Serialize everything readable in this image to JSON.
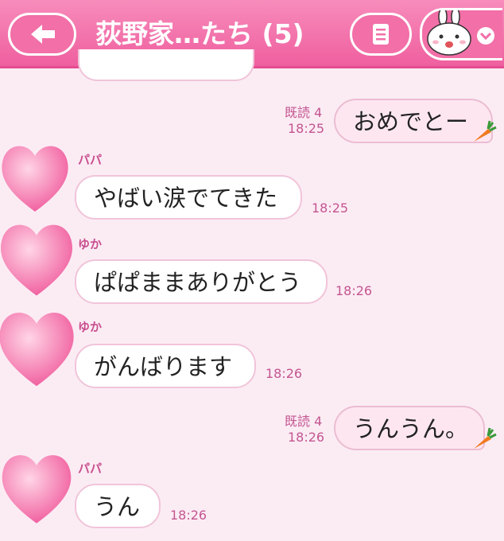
{
  "header": {
    "title": "荻野家…たち (5)",
    "accent": "#ef5f9f"
  },
  "messages": [
    {
      "kind": "out",
      "text": "おめでとー",
      "read": "既読 4",
      "time": "18:25",
      "sticker": "carrot-icon"
    },
    {
      "kind": "in",
      "sender": "パパ",
      "text": "やばい涙でてきた",
      "time": "18:25"
    },
    {
      "kind": "in",
      "sender": "ゆか",
      "text": "ぱぱままありがとう",
      "time": "18:26"
    },
    {
      "kind": "in",
      "sender": "ゆか",
      "text": "がんばります",
      "time": "18:26"
    },
    {
      "kind": "out",
      "text": "うんうん。",
      "read": "既読 4",
      "time": "18:26",
      "sticker": "carrot-icon"
    },
    {
      "kind": "in",
      "sender": "パパ",
      "text": "うん",
      "time": "18:26"
    }
  ]
}
